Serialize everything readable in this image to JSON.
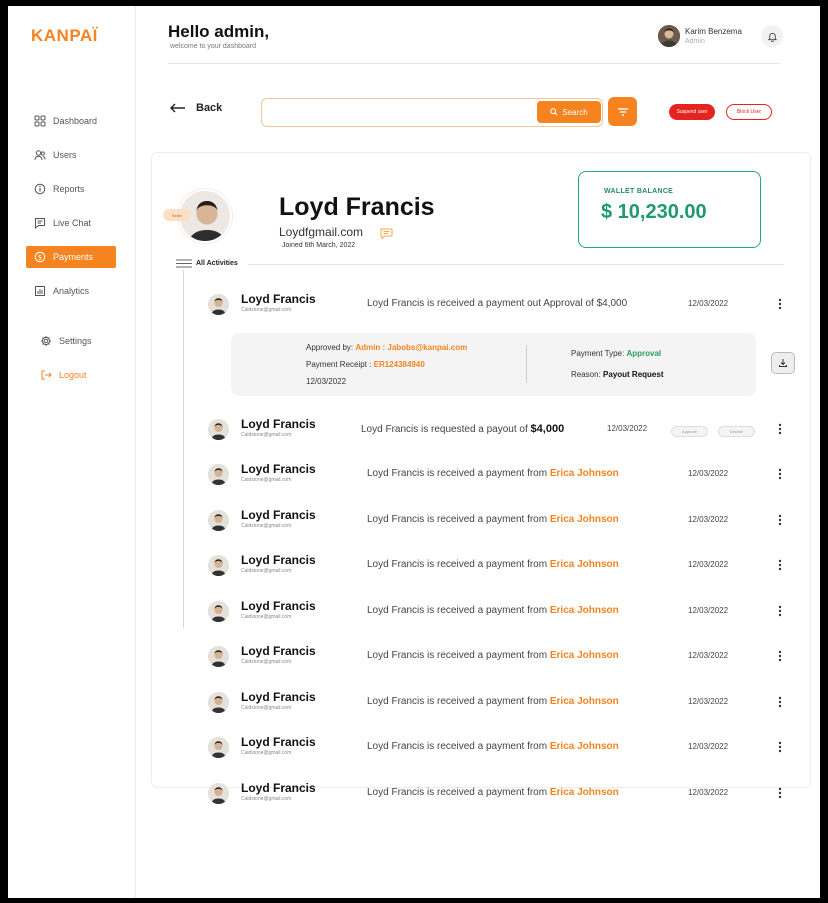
{
  "brand": {
    "logo": "KANPAÏ",
    "accent": "#f58320"
  },
  "sidebar": {
    "items": [
      {
        "label": "Dashboard",
        "icon": "grid-icon"
      },
      {
        "label": "Users",
        "icon": "users-icon"
      },
      {
        "label": "Reports",
        "icon": "info-icon"
      },
      {
        "label": "Live Chat",
        "icon": "chat-icon"
      },
      {
        "label": "Payments",
        "icon": "dollar-icon",
        "active": true
      },
      {
        "label": "Analytics",
        "icon": "chart-icon"
      },
      {
        "label": "Settings",
        "icon": "gear-icon"
      },
      {
        "label": "Logout",
        "icon": "logout-icon"
      }
    ]
  },
  "header": {
    "greeting": "Hello admin,",
    "subtitle": "welcome to your dashboard",
    "user_name": "Karim Benzema",
    "user_role": "Admin"
  },
  "toolbar": {
    "back_label": "Back",
    "search_placeholder": "",
    "search_label": "Search",
    "suspend_label": "Suspend user",
    "block_label": "Block User"
  },
  "profile": {
    "tag": "Seller",
    "name": "Loyd Francis",
    "email": "Loydfgmail.com",
    "joined": "Joined 6th March, 2022"
  },
  "wallet": {
    "label": "WALLET BALANCE",
    "amount": "$ 10,230.00",
    "color": "#1f9a6c"
  },
  "activities": {
    "label": "All Activities",
    "first": {
      "name": "Loyd Francis",
      "email": "Caldstone@gmail.com",
      "message": "Loyd Francis is received a payment out Approval of $4,000",
      "date": "12/03/2022"
    },
    "detail": {
      "approved_by_label": "Approved by:",
      "approved_by_value": "Admin : Jabobs@kanpai.com",
      "receipt_label": "Payment Receipt :",
      "receipt_value": "ER124384940",
      "date": "12/03/2022",
      "type_label": "Payment Type:",
      "type_value": "Approval",
      "reason_label": "Reason:",
      "reason_value": "Payout Request"
    },
    "request": {
      "name": "Loyd Francis",
      "email": "Caldstone@gmail.com",
      "message": "Loyd Francis is requested a payout of",
      "amount": "$4,000",
      "date": "12/03/2022",
      "approve_label": "Approve",
      "decline_label": "Decline"
    },
    "rows": [
      {
        "name": "Loyd Francis",
        "email": "Caldstone@gmail.com",
        "message": "Loyd Francis is received a payment from",
        "from": "Erica Johnson",
        "date": "12/03/2022"
      },
      {
        "name": "Loyd Francis",
        "email": "Caldstone@gmail.com",
        "message": "Loyd Francis is received a payment from",
        "from": "Erica Johnson",
        "date": "12/03/2022"
      },
      {
        "name": "Loyd Francis",
        "email": "Caldstone@gmail.com",
        "message": "Loyd Francis is received a payment from",
        "from": "Erica Johnson",
        "date": "12/03/2022"
      },
      {
        "name": "Loyd Francis",
        "email": "Caldstone@gmail.com",
        "message": "Loyd Francis is received a payment from",
        "from": "Erica Johnson",
        "date": "12/03/2022"
      },
      {
        "name": "Loyd Francis",
        "email": "Caldstone@gmail.com",
        "message": "Loyd Francis is received a payment from",
        "from": "Erica Johnson",
        "date": "12/03/2022"
      },
      {
        "name": "Loyd Francis",
        "email": "Caldstone@gmail.com",
        "message": "Loyd Francis is received a payment from",
        "from": "Erica Johnson",
        "date": "12/03/2022"
      },
      {
        "name": "Loyd Francis",
        "email": "Caldstone@gmail.com",
        "message": "Loyd Francis is received a payment from",
        "from": "Erica Johnson",
        "date": "12/03/2022"
      },
      {
        "name": "Loyd Francis",
        "email": "Caldstone@gmail.com",
        "message": "Loyd Francis is received a payment from",
        "from": "Erica Johnson",
        "date": "12/03/2022"
      }
    ]
  }
}
